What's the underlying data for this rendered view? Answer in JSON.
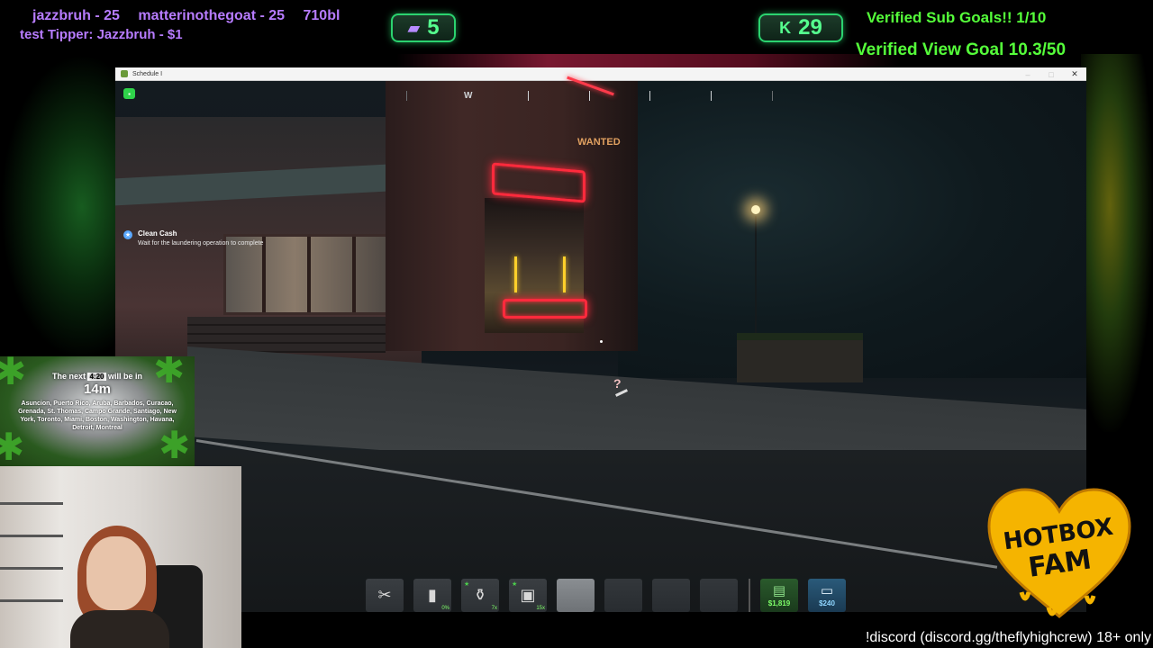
{
  "overlay": {
    "gifters": [
      "jazzbruh - 25",
      "matterinothegoat - 25",
      "710bl"
    ],
    "tipper": "test Tipper: Jazzbruh - $1",
    "twitch_count": "5",
    "kick_count": "29",
    "sub_goal": "Verified Sub Goals!! 1/10",
    "view_goal": "Verified View Goal 10.3/50",
    "discord": "!discord (discord.gg/theflyhighcrew) 18+ only",
    "timer": {
      "prefix": "The next",
      "tag": "4:20",
      "suffix": "will be in",
      "remaining": "14m",
      "cities": "Asuncion, Puerto Rico, Aruba, Barbados, Curacao, Grenada, St. Thomas, Campo Grande, Santiago, New York, Toronto, Miami, Boston, Washington, Havana, Detroit, Montreal"
    },
    "logo_lines": [
      "HOTBOX",
      "FAM"
    ]
  },
  "window": {
    "title": "Schedule I",
    "controls": [
      "–",
      "□",
      "✕"
    ]
  },
  "hud": {
    "compass_label": "W",
    "wanted": "WANTED",
    "objective": {
      "title": "Clean Cash",
      "description": "Wait for the laundering operation to complete"
    },
    "cursor_symbol": "?",
    "hotbar": [
      {
        "icon": "clippers-icon",
        "glyph": "✂",
        "qty": ""
      },
      {
        "icon": "bag-icon",
        "glyph": "▮",
        "qty": "0%"
      },
      {
        "icon": "jar-icon",
        "glyph": "⚱",
        "qty": "7x",
        "star": true
      },
      {
        "icon": "package-icon",
        "glyph": "▣",
        "qty": "15x",
        "star": true
      },
      {
        "icon": "",
        "glyph": "",
        "qty": ""
      },
      {
        "icon": "",
        "glyph": "",
        "qty": ""
      },
      {
        "icon": "",
        "glyph": "",
        "qty": ""
      },
      {
        "icon": "",
        "glyph": "",
        "qty": ""
      }
    ],
    "cash": "$1,819",
    "bank": "$240"
  }
}
